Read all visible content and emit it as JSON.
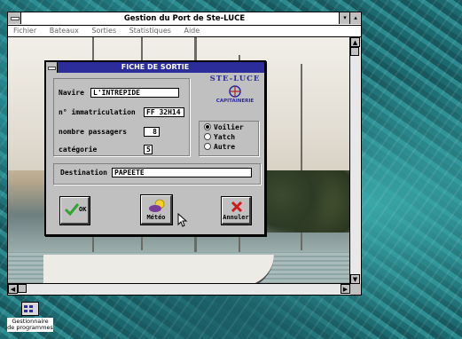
{
  "main_window": {
    "title": "Gestion du Port de Ste-LUCE",
    "min_glyph": "▾",
    "max_glyph": "▴",
    "menu": [
      "Fichier",
      "Bateaux",
      "Sorties",
      "Statistiques",
      "Aide"
    ]
  },
  "dialog": {
    "title": "FICHE DE SORTIE",
    "fields": {
      "navire": {
        "label": "Navire",
        "value": "L'INTREPIDE"
      },
      "immatriculation": {
        "label": "n° immatriculation",
        "value": "FF 32H14"
      },
      "passagers": {
        "label": "nombre passagers",
        "value": "8"
      },
      "categorie": {
        "label": "catégorie",
        "value": "5"
      },
      "destination": {
        "label": "Destination",
        "value": "PAPEETE"
      }
    },
    "type_options": [
      {
        "label": "Voilier",
        "selected": true
      },
      {
        "label": "Yatch",
        "selected": false
      },
      {
        "label": "Autre",
        "selected": false
      }
    ],
    "logo": {
      "name": "STE-LUCE",
      "sub": "CAPITAINERIE"
    },
    "buttons": {
      "ok": "OK",
      "meteo": "Météo",
      "annuler": "Annuler"
    }
  },
  "desktop_icon": {
    "line1": "Gestionnaire",
    "line2": "de programmes"
  },
  "colors": {
    "dialog_title_bg": "#2c2c9a",
    "ok_check": "#2fa52f",
    "cancel_x": "#cc1b1b"
  }
}
